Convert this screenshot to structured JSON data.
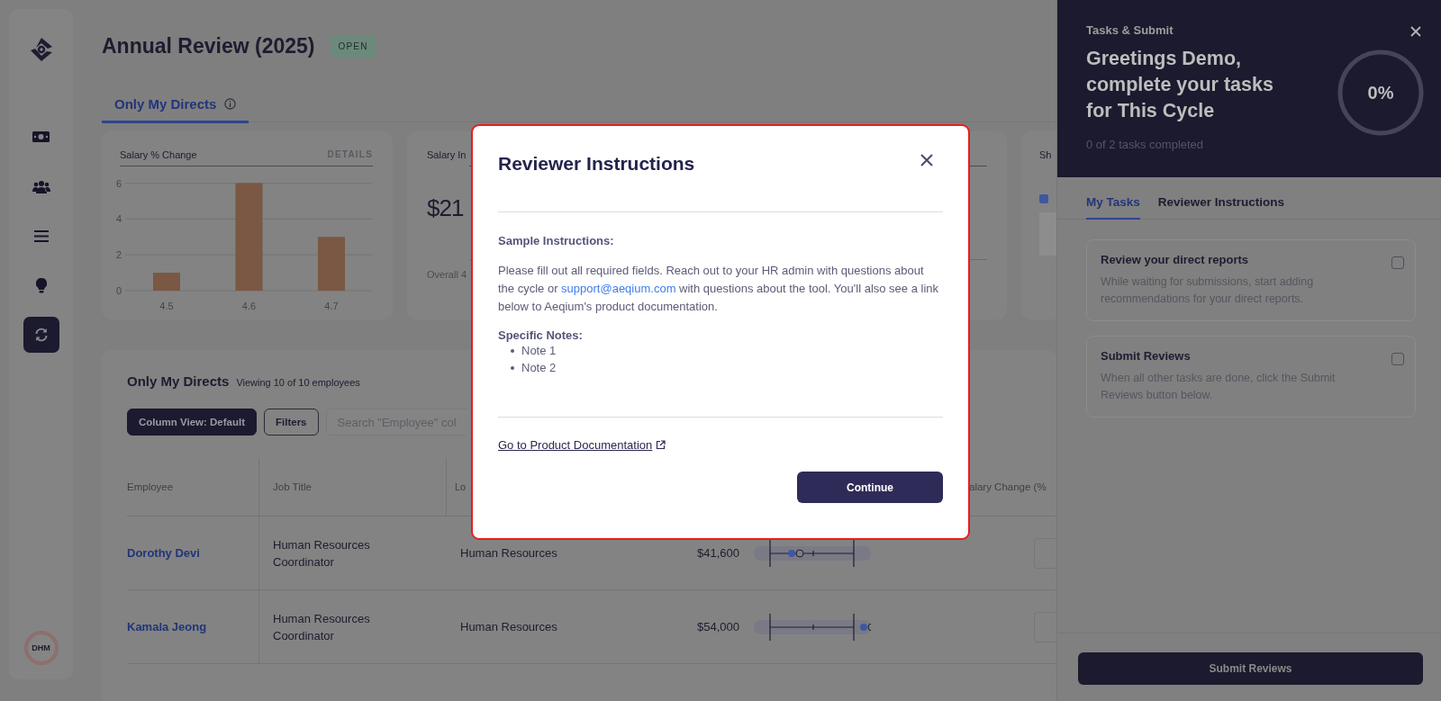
{
  "sidebar": {
    "items": [
      {
        "selected": false
      },
      {
        "selected": false
      },
      {
        "selected": false
      },
      {
        "selected": false
      },
      {
        "selected": true
      }
    ],
    "avatar": "DHM"
  },
  "header": {
    "title": "Annual Review (2025)",
    "status": "OPEN"
  },
  "tabs": [
    {
      "label": "Only My Directs",
      "selected": true
    }
  ],
  "cards": [
    {
      "title": "Salary % Change",
      "action": "DETAILS",
      "chart_data": {
        "type": "bar",
        "categories": [
          "4.5",
          "4.6",
          "4.7"
        ],
        "values": [
          1,
          6,
          3
        ],
        "ylim": [
          0,
          6
        ],
        "yticks": [
          0,
          2,
          4,
          6
        ]
      }
    },
    {
      "title": "Salary In",
      "value": "$21",
      "footer": "Overall 4"
    },
    {
      "title": "Sh"
    }
  ],
  "table_section": {
    "title": "Only My Directs",
    "count": "Viewing 10 of 10 employees",
    "buttons": [
      {
        "label": "Column View: Default",
        "kind": "primary"
      },
      {
        "label": "Filters",
        "kind": "outline"
      }
    ],
    "search": {
      "placeholder": "Search \"Employee\" col"
    },
    "columns": [
      {
        "label": "Employee"
      },
      {
        "label": "Job Title"
      },
      {
        "label": "Lo"
      },
      {
        "label": "alary Change (%"
      }
    ],
    "rows": [
      {
        "employee": "Dorothy Devi",
        "job_title": "Human Resources Coordinator",
        "column_3": "Human Resources",
        "salary": "$41,600"
      },
      {
        "employee": "Kamala Jeong",
        "job_title": "Human Resources Coordinator",
        "column_3": "Human Resources",
        "salary": "$54,000"
      }
    ]
  },
  "modal": {
    "title": "Reviewer Instructions",
    "heading": "Sample Instructions:",
    "text_before": "Please fill out all required fields. Reach out to your HR admin with questions about the cycle or",
    "link": "support@aeqium.com",
    "text_after": "with questions about the tool. You'll also see a link below to Aeqium's product documentation.",
    "notes_heading": "Specific Notes:",
    "notes": [
      "Note 1",
      "Note 2"
    ],
    "doc_link": "Go to Product Documentation",
    "button": "Continue"
  },
  "panel": {
    "eyebrow": "Tasks & Submit",
    "heading": "Greetings Demo, complete your tasks for This Cycle",
    "progress": {
      "label": "0%",
      "level": 0
    },
    "summary": "0 of 2 tasks completed",
    "tabs": [
      {
        "label": "My Tasks",
        "selected": true
      },
      {
        "label": "Reviewer Instructions",
        "selected": false
      }
    ],
    "tasks": [
      {
        "title": "Review your direct reports",
        "description": "While waiting for submissions, start adding recommendations for your direct reports.",
        "checked": false
      },
      {
        "title": "Submit Reviews",
        "description": "When all other tasks are done, click the Submit Reviews button below.",
        "checked": false
      }
    ],
    "submit": "Submit Reviews"
  }
}
